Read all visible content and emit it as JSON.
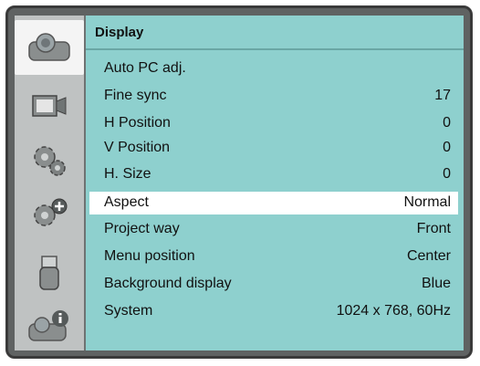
{
  "menu": {
    "title": "Display",
    "sidebar_icons": [
      "camera-icon",
      "input-source-icon",
      "gear-icon",
      "gear-plus-icon",
      "usb-drive-icon",
      "camera-info-icon"
    ],
    "items": [
      {
        "label": "Auto PC adj.",
        "value": ""
      },
      {
        "label": "Fine sync",
        "value": "17"
      },
      {
        "label": "H Position",
        "value": "0"
      },
      {
        "label": "V Position",
        "value": "0"
      },
      {
        "label": "H. Size",
        "value": "0"
      },
      {
        "label": "Aspect",
        "value": "Normal"
      },
      {
        "label": "Project way",
        "value": "Front"
      },
      {
        "label": "Menu position",
        "value": "Center"
      },
      {
        "label": "Background display",
        "value": "Blue"
      },
      {
        "label": "System",
        "value": "1024 x 768, 60Hz"
      }
    ],
    "selected_item": "Aspect"
  },
  "colors": {
    "content_bg": "#8ed0ce",
    "sidebar_bg": "#bfc2c2",
    "frame": "#3a3a3a",
    "selected_row": "#ffffff"
  }
}
